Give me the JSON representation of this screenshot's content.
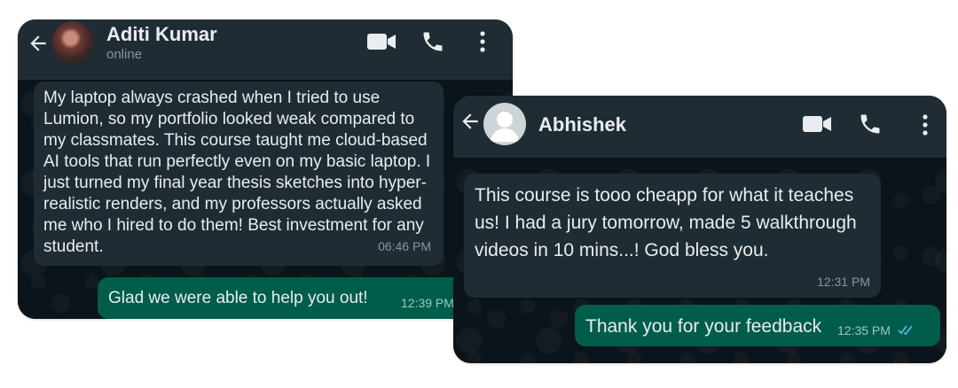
{
  "chats": [
    {
      "contact_name": "Aditi Kumar",
      "status": "online",
      "messages": [
        {
          "direction": "incoming",
          "text": "My laptop always crashed when I tried to use Lumion, so my portfolio looked weak compared to my classmates. This course taught me cloud-based AI tools that run perfectly even on my basic laptop. I just turned my final year thesis sketches into hyper-realistic renders, and my professors actually asked me who I hired to do them! Best investment for any student.",
          "time": "06:46 PM"
        },
        {
          "direction": "outgoing",
          "text": "Glad we were able to help you out!",
          "time": "12:39 PM"
        }
      ]
    },
    {
      "contact_name": "Abhishek",
      "messages": [
        {
          "direction": "incoming",
          "text": "This course is tooo cheapp for what it teaches us! I had a jury tomorrow, made 5 walkthrough videos in 10 mins...! God bless you.",
          "time": "12:31 PM"
        },
        {
          "direction": "outgoing",
          "text": "Thank you for your feedback",
          "time": "12:35 PM",
          "read_receipt": "double-check-icon"
        }
      ]
    }
  ],
  "colors": {
    "wallpaper": "#0b141a",
    "header": "#1f2c34",
    "incoming_bubble": "#1f2c34",
    "outgoing_bubble": "#005c4b",
    "read_tick": "#53bdeb"
  }
}
